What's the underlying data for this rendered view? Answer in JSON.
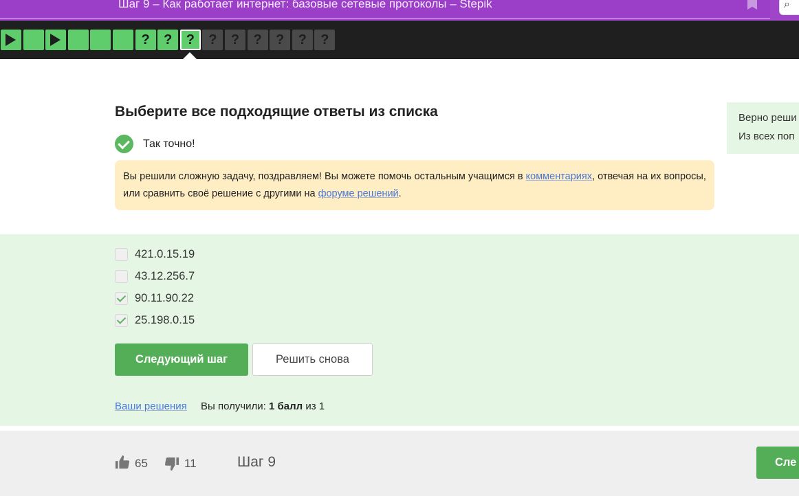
{
  "browser": {
    "tab_title": "Шаг 9 – Как работает интернет: базовые сетевые протоколы – Stepik",
    "bookmark_icon": "bookmark-icon",
    "search_icon": "search-icon"
  },
  "stepbar": {
    "steps": [
      {
        "kind": "video",
        "status": "done"
      },
      {
        "kind": "text",
        "status": "done"
      },
      {
        "kind": "video",
        "status": "done"
      },
      {
        "kind": "text",
        "status": "done"
      },
      {
        "kind": "text",
        "status": "done"
      },
      {
        "kind": "text",
        "status": "done"
      },
      {
        "kind": "quiz",
        "status": "done",
        "label": "?"
      },
      {
        "kind": "quiz",
        "status": "done",
        "label": "?"
      },
      {
        "kind": "quiz",
        "status": "current",
        "label": "?"
      },
      {
        "kind": "quiz",
        "status": "todo",
        "label": "?"
      },
      {
        "kind": "quiz",
        "status": "todo",
        "label": "?"
      },
      {
        "kind": "quiz",
        "status": "todo",
        "label": "?"
      },
      {
        "kind": "quiz",
        "status": "todo",
        "label": "?"
      },
      {
        "kind": "quiz",
        "status": "todo",
        "label": "?"
      },
      {
        "kind": "quiz",
        "status": "todo",
        "label": "?"
      }
    ],
    "colors": {
      "done": "#5fcd6b",
      "todo": "#4a4a4a",
      "bar": "#1f1f1f"
    }
  },
  "quiz": {
    "title": "Выберите все подходящие ответы из списка",
    "correct_text": "Так точно!",
    "notice": {
      "part1": "Вы решили сложную задачу, поздравляем! Вы можете помочь остальным учащимся в ",
      "link1": "комментариях",
      "part2": ", отвечая на их вопросы, или сравнить своё решение с другими на ",
      "link2": "форуме решений",
      "part3": "."
    },
    "options": [
      {
        "label": "421.0.15.19",
        "checked": false
      },
      {
        "label": "43.12.256.7",
        "checked": false
      },
      {
        "label": "90.11.90.22",
        "checked": true
      },
      {
        "label": "25.198.0.15",
        "checked": true
      }
    ],
    "next_button": "Следующий шаг",
    "retry_button": "Решить снова",
    "solutions_link": "Ваши решения",
    "score_prefix": "Вы получили: ",
    "score_bold": "1 балл",
    "score_suffix": " из 1"
  },
  "side_panel": {
    "line1": "Верно реши",
    "line2": "Из всех поп"
  },
  "footer": {
    "likes": "65",
    "dislikes": "11",
    "step_label": "Шаг 9",
    "next_button": "Сле"
  },
  "colors": {
    "accent_green": "#54ad57",
    "success_bg": "#e6f6e4",
    "notice_bg": "#ffedc3",
    "link": "#4a78d6",
    "browser_purple": "#9b3fc8"
  }
}
